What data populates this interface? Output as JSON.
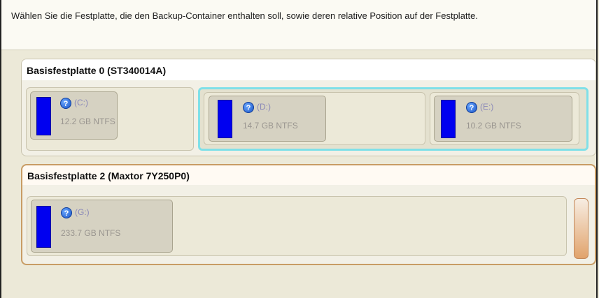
{
  "instruction": "Wählen Sie die Festplatte, die den Backup-Container enthalten soll, sowie deren relative Position auf der Festplatte.",
  "disks": [
    {
      "title": "Basisfestplatte 0 (ST340014A)",
      "partitions": [
        {
          "letter": "(C:)",
          "size": "12.2 GB NTFS"
        },
        {
          "letter": "(D:)",
          "size": "14.7 GB NTFS"
        },
        {
          "letter": "(E:)",
          "size": "10.2 GB NTFS"
        }
      ]
    },
    {
      "title": "Basisfestplatte 2 (Maxtor 7Y250P0)",
      "partitions": [
        {
          "letter": "(G:)",
          "size": "233.7 GB NTFS"
        }
      ]
    }
  ],
  "icons": {
    "help": "question-mark-icon"
  },
  "colors": {
    "partition_fill": "#0000f0",
    "selected_extended": "#7fe0e8",
    "selected_disk_border": "#c89c64"
  }
}
